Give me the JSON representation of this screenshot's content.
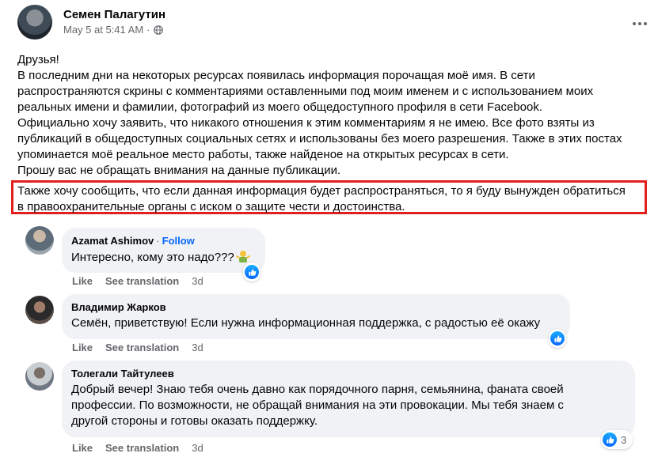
{
  "post": {
    "author": "Семен Палагутин",
    "timestamp": "May 5 at 5:41 AM",
    "privacy_icon": "globe-icon",
    "paragraphs": [
      "Друзья!",
      "В последним дни на некоторых ресурсах появилась информация порочащая моё имя. В сети",
      "распространяются скрины с комментариями оставленными под моим именем и с использованием моих",
      "реальных имени и фамилии, фотографий из моего общедоступного профиля в сети Facebook.",
      "Официально хочу заявить, что никакого отношения к этим комментариям я не имею. Все фото взяты из",
      "публикаций в общедоступных социальных сетях и использованы без моего разрешения. Также в этих постах",
      "упоминается моё реальное место работы, также найденое на открытых ресурсах в сети.",
      "Прошу вас не обращать внимания на данные публикации."
    ],
    "highlighted_paragraphs": [
      "Также хочу сообщить, что если данная информация будет распространяться, то я буду вынужден обратиться",
      "в правоохранительные органы с иском о защите чести и достоинства."
    ],
    "highlight_color": "#e0201f"
  },
  "comments": [
    {
      "author": "Azamat Ashimov",
      "separator": "·",
      "follow_label": "Follow",
      "lines": [
        "Интересно, кому это надо???"
      ],
      "like_label": "Like",
      "translate_label": "See translation",
      "time": "3d",
      "reaction_count": ""
    },
    {
      "author": "Владимир Жарков",
      "lines": [
        "Семён, приветствую! Если нужна информационная поддержка, с радостью её окажу"
      ],
      "like_label": "Like",
      "translate_label": "See translation",
      "time": "3d",
      "reaction_count": ""
    },
    {
      "author": "Толегали Тайтулеев",
      "lines": [
        "Добрый вечер! Знаю тебя очень давно как порядочного парня, семьянина, фаната своей",
        "профессии. По возможности, не обращай внимания на эти провокации. Мы тебя знаем с",
        "другой стороны и готовы оказать поддержку."
      ],
      "like_label": "Like",
      "translate_label": "See translation",
      "time": "3d",
      "reaction_count": "3"
    }
  ],
  "colors": {
    "accent": "#0866ff",
    "bubble": "#f0f2f5",
    "secondary_text": "#65676b"
  }
}
